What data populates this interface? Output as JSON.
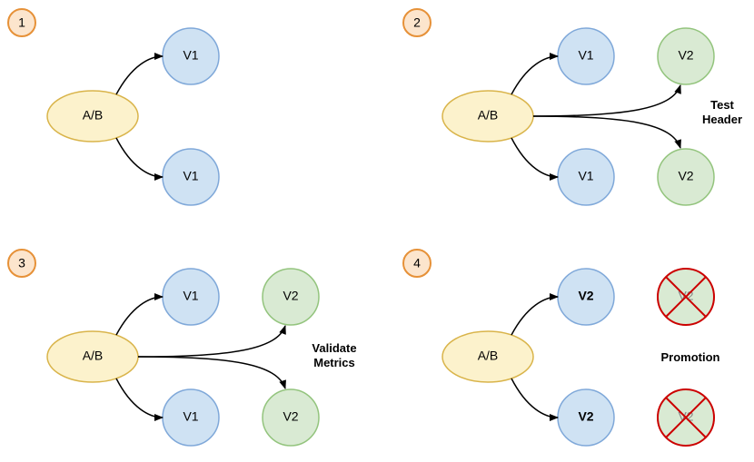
{
  "colors": {
    "badge_fill": "#FCE5CD",
    "badge_stroke": "#E69138",
    "ab_fill": "#FCF2CC",
    "ab_stroke": "#D9B44A",
    "v1_fill": "#CFE2F3",
    "v1_stroke": "#7FA8D9",
    "v2_fill": "#D9EAD3",
    "v2_stroke": "#93C47D",
    "cross_stroke": "#CC0000",
    "arrow": "#000000"
  },
  "labels": {
    "ab": "A/B",
    "v1": "V1",
    "v2": "V2",
    "s1": "1",
    "s2": "2",
    "s3": "3",
    "s4": "4",
    "test_header_l1": "Test",
    "test_header_l2": "Header",
    "validate_l1": "Validate",
    "validate_l2": "Metrics",
    "promotion": "Promotion"
  }
}
